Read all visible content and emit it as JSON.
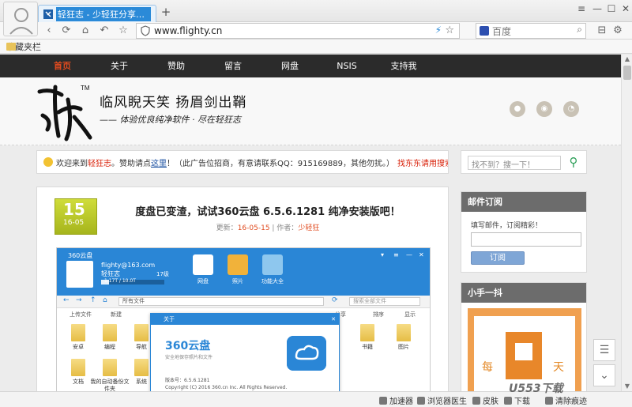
{
  "browser": {
    "tab_title": "轻狂志 - 少轻狂分享优质软件",
    "new_tab": "+",
    "window_controls": [
      "≡",
      "—",
      "☐",
      "✕"
    ],
    "url": "www.flighty.cn",
    "search_placeholder": "百度",
    "favorites_label": "收藏夹栏"
  },
  "site": {
    "nav": [
      "首页",
      "关于",
      "赞助",
      "留言",
      "网盘",
      "NSIS",
      "支持我"
    ],
    "slogan": "临风睨天笑   扬眉剑出鞘",
    "subslogan": "—— 体验优良纯净软件 · 尽在轻狂志",
    "logo_tm": "TM",
    "notice": {
      "part1": "欢迎来到",
      "site_name": "轻狂志",
      "part2": "。赞助请点",
      "link": "这里",
      "part3": "！（此广告位招商，有意请联系QQ：915169889，其他勿扰。）",
      "cta": "找东东请用搜索====>>"
    },
    "post": {
      "day": "15",
      "ym": "16-05",
      "title": "度盘已变渣，试试360云盘 6.5.6.1281 纯净安装版吧！",
      "meta_prefix": "更新：",
      "meta_date": "16-05-15",
      "meta_sep": " | 作者：",
      "meta_author": "少轻狂"
    },
    "screenshot": {
      "brand": "360云盘",
      "account": "flighty@163.com",
      "nickname": "轻狂志",
      "level": "17级",
      "usage": "1.17T / 10.0T",
      "usage_fraction": 0.12,
      "tools": [
        "网盘",
        "照片",
        "功能大全"
      ],
      "path": "所有文件",
      "search_placeholder": "搜索全部文件",
      "toolbar": [
        "上传文件",
        "新建",
        "分享",
        "排序",
        "显示"
      ],
      "folders": [
        "安卓",
        "编程",
        "导航",
        "书籍",
        "图片",
        "文档",
        "我的自动备份文件夹",
        "系统"
      ],
      "dialog": {
        "title": "关于",
        "close": "✕",
        "name": "360云盘",
        "tagline": "安全地保存照片和文件",
        "version": "版本号：6.5.6.1281",
        "copyright": "Copyright (C) 2016 360.cn Inc. All Rights Reserved."
      }
    },
    "sidebar": {
      "search_placeholder": "找不到？搜一下！",
      "mail_title": "邮件订阅",
      "mail_tip": "填写邮件，订阅精彩！",
      "mail_button": "订阅",
      "video_title": "小手一抖",
      "video_chars": [
        "每",
        "天"
      ]
    }
  },
  "statusbar": [
    "加速器",
    "浏览器医生",
    "皮肤",
    "下载",
    "清除痕迹"
  ],
  "watermark": "U553下载"
}
